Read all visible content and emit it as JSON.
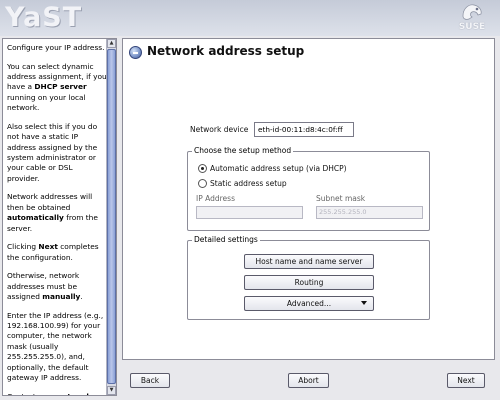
{
  "header": {
    "app_logo": "YaST",
    "brand_logo": "SUSE"
  },
  "help": {
    "paragraphs": [
      {
        "parts": [
          {
            "t": "Configure your IP address."
          }
        ]
      },
      {
        "parts": [
          {
            "t": "You can select dynamic address assignment, if you have a "
          },
          {
            "t": "DHCP server",
            "b": true
          },
          {
            "t": " running on your local network."
          }
        ]
      },
      {
        "parts": [
          {
            "t": "Also select this if you do not have a static IP address assigned by the system administrator or your cable or DSL provider."
          }
        ]
      },
      {
        "parts": [
          {
            "t": "Network addresses will then be obtained "
          },
          {
            "t": "automatically",
            "b": true
          },
          {
            "t": " from the server."
          }
        ]
      },
      {
        "parts": [
          {
            "t": "Clicking "
          },
          {
            "t": "Next",
            "b": true
          },
          {
            "t": " completes the configuration."
          }
        ]
      },
      {
        "parts": [
          {
            "t": "Otherwise, network addresses must be assigned "
          },
          {
            "t": "manually",
            "b": true
          },
          {
            "t": "."
          }
        ]
      },
      {
        "parts": [
          {
            "t": "Enter the IP address (e.g., 192.168.100.99) for your computer, the network mask (usually 255.255.255.0), and, optionally, the default gateway IP address."
          }
        ]
      },
      {
        "parts": [
          {
            "t": "Contact your "
          },
          {
            "t": "network",
            "b": true
          }
        ]
      }
    ]
  },
  "main": {
    "title": "Network address setup",
    "device_label": "Network device",
    "device_value": "eth-id-00:11:d8:4c:0f:ff",
    "setup_method": {
      "title": "Choose the setup method",
      "automatic_label": "Automatic address setup (via DHCP)",
      "static_label": "Static address setup",
      "selected": "automatic",
      "ip_label": "IP Address",
      "ip_value": "",
      "mask_label": "Subnet mask",
      "mask_value": "255.255.255.0"
    },
    "detailed": {
      "title": "Detailed settings",
      "hostname_button": "Host name and name server",
      "routing_button": "Routing",
      "advanced_button": "Advanced..."
    }
  },
  "footer": {
    "back": "Back",
    "abort": "Abort",
    "next": "Next"
  }
}
